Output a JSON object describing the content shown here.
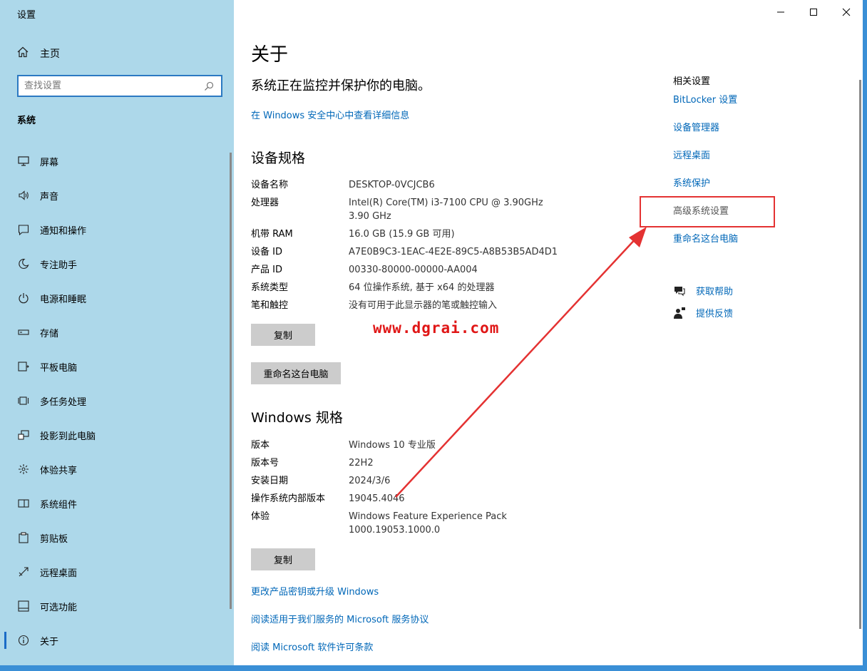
{
  "window": {
    "title": "设置"
  },
  "sidebar": {
    "home": "主页",
    "search_placeholder": "查找设置",
    "section": "系统",
    "items": [
      {
        "label": "屏幕",
        "icon": "monitor-icon"
      },
      {
        "label": "声音",
        "icon": "speaker-icon"
      },
      {
        "label": "通知和操作",
        "icon": "notification-icon"
      },
      {
        "label": "专注助手",
        "icon": "moon-icon"
      },
      {
        "label": "电源和睡眠",
        "icon": "power-icon"
      },
      {
        "label": "存储",
        "icon": "storage-icon"
      },
      {
        "label": "平板电脑",
        "icon": "tablet-icon"
      },
      {
        "label": "多任务处理",
        "icon": "multitask-icon"
      },
      {
        "label": "投影到此电脑",
        "icon": "project-icon"
      },
      {
        "label": "体验共享",
        "icon": "share-icon"
      },
      {
        "label": "系统组件",
        "icon": "components-icon"
      },
      {
        "label": "剪贴板",
        "icon": "clipboard-icon"
      },
      {
        "label": "远程桌面",
        "icon": "remote-icon"
      },
      {
        "label": "可选功能",
        "icon": "optional-icon"
      },
      {
        "label": "关于",
        "icon": "info-icon"
      }
    ]
  },
  "main": {
    "title": "关于",
    "protect_text": "系统正在监控并保护你的电脑。",
    "security_link": "在 Windows 安全中心中查看详细信息",
    "device_spec": {
      "heading": "设备规格",
      "rows": [
        {
          "k": "设备名称",
          "v": "DESKTOP-0VCJCB6"
        },
        {
          "k": "处理器",
          "v": "Intel(R) Core(TM) i3-7100 CPU @ 3.90GHz   3.90 GHz"
        },
        {
          "k": "机带 RAM",
          "v": "16.0 GB (15.9 GB 可用)"
        },
        {
          "k": "设备 ID",
          "v": "A7E0B9C3-1EAC-4E2E-89C5-A8B53B5AD4D1"
        },
        {
          "k": "产品 ID",
          "v": "00330-80000-00000-AA004"
        },
        {
          "k": "系统类型",
          "v": "64 位操作系统, 基于 x64 的处理器"
        },
        {
          "k": "笔和触控",
          "v": "没有可用于此显示器的笔或触控输入"
        }
      ],
      "copy_button": "复制",
      "rename_button": "重命名这台电脑"
    },
    "windows_spec": {
      "heading": "Windows 规格",
      "rows": [
        {
          "k": "版本",
          "v": "Windows 10 专业版"
        },
        {
          "k": "版本号",
          "v": "22H2"
        },
        {
          "k": "安装日期",
          "v": "2024/3/6"
        },
        {
          "k": "操作系统内部版本",
          "v": "19045.4046"
        },
        {
          "k": "体验",
          "v": "Windows Feature Experience Pack 1000.19053.1000.0"
        }
      ],
      "copy_button": "复制"
    },
    "bottom_links": [
      "更改产品密钥或升级 Windows",
      "阅读适用于我们服务的 Microsoft 服务协议",
      "阅读 Microsoft 软件许可条款"
    ]
  },
  "related": {
    "heading": "相关设置",
    "items": [
      {
        "label": "BitLocker 设置",
        "style": "link"
      },
      {
        "label": "设备管理器",
        "style": "link"
      },
      {
        "label": "远程桌面",
        "style": "link"
      },
      {
        "label": "系统保护",
        "style": "link"
      },
      {
        "label": "高级系统设置",
        "style": "gray"
      },
      {
        "label": "重命名这台电脑",
        "style": "link"
      }
    ],
    "help": [
      {
        "label": "获取帮助",
        "icon": "help-chat-icon"
      },
      {
        "label": "提供反馈",
        "icon": "feedback-icon"
      }
    ]
  },
  "annotation": {
    "watermark": "www.dgrai.com",
    "color": "#e43232"
  }
}
